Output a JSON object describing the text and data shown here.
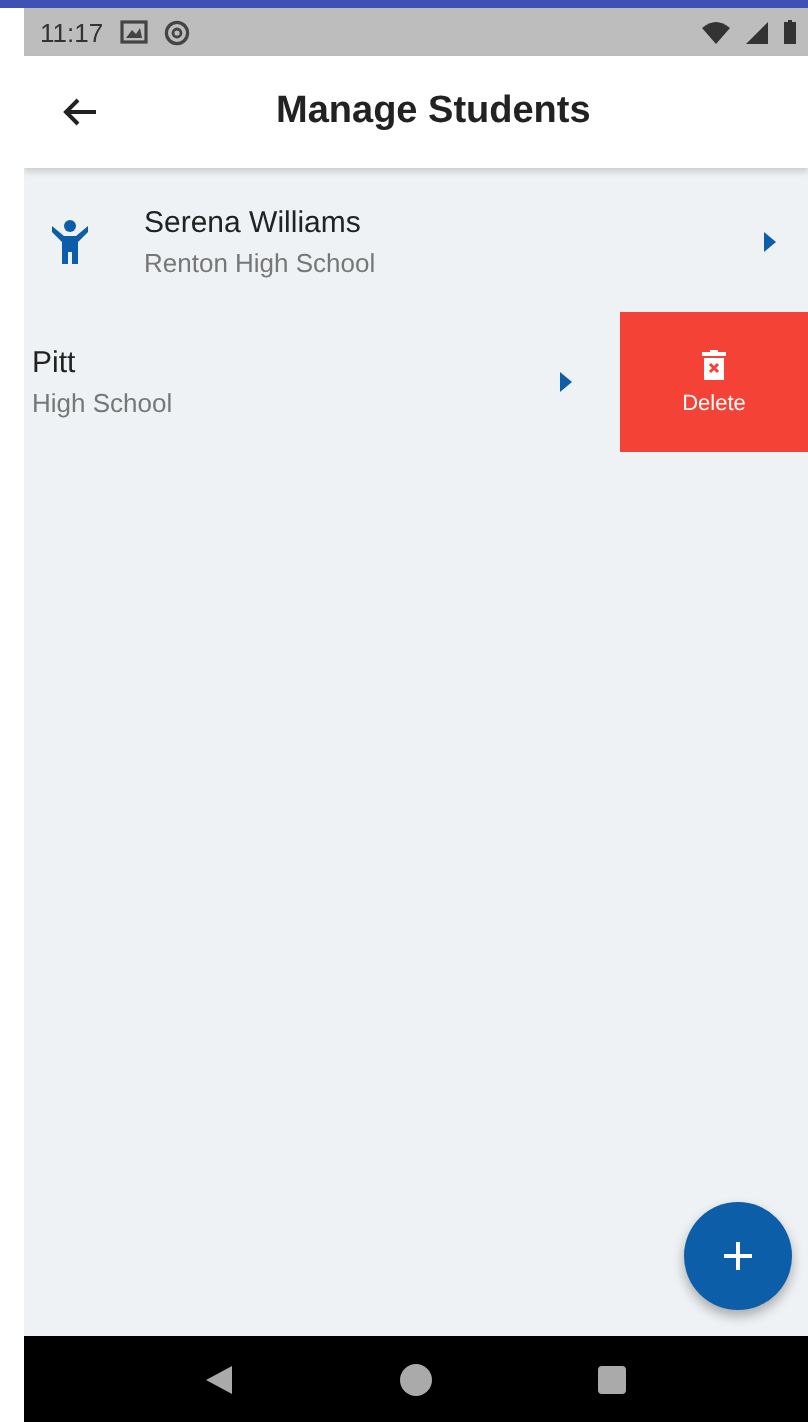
{
  "status_bar": {
    "time": "11:17"
  },
  "app_bar": {
    "title": "Manage Students"
  },
  "students": [
    {
      "kind": "normal",
      "name": "Serena Williams",
      "school": "Renton High School"
    },
    {
      "kind": "swiped",
      "name": "Pitt",
      "school": "High School",
      "action": "Delete"
    }
  ]
}
